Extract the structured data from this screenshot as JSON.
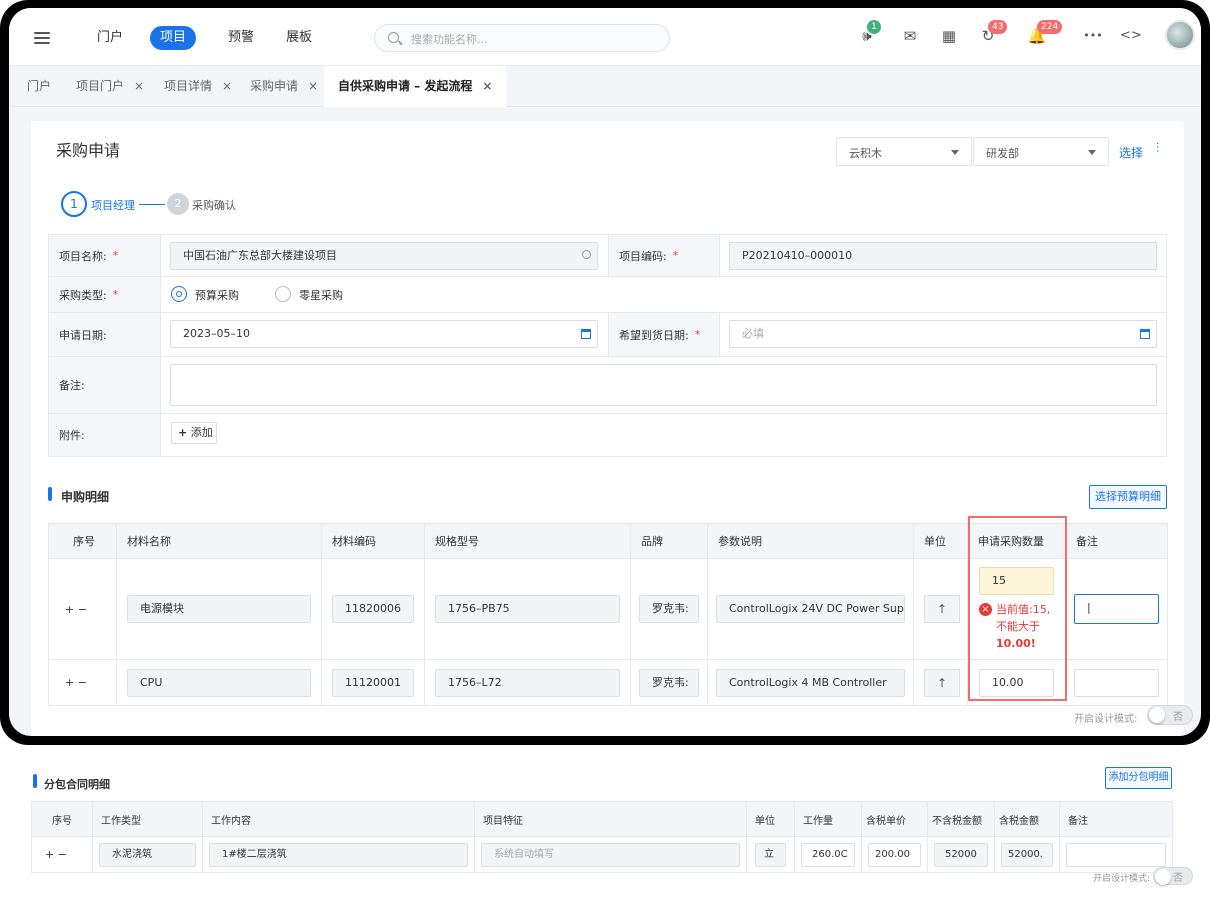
{
  "nav": {
    "items": [
      "门户",
      "项目",
      "预警",
      "展板"
    ],
    "active": "项目"
  },
  "search": {
    "placeholder": "搜索功能名称..."
  },
  "toolbar": {
    "badge_notify": "1",
    "badge_sync": "43",
    "badge_alarm": "224",
    "more": "•••",
    "code": "<>"
  },
  "tabs": [
    {
      "label": "门户"
    },
    {
      "label": "项目门户"
    },
    {
      "label": "项目详情"
    },
    {
      "label": "采购申请"
    },
    {
      "label": "自供采购申请 – 发起流程"
    }
  ],
  "page": {
    "title": "采购申请",
    "company": "云积木",
    "dept": "研发部",
    "select_link": "选择"
  },
  "steps": [
    {
      "num": "1",
      "label": "项目经理"
    },
    {
      "num": "2",
      "label": "采购确认"
    }
  ],
  "form": {
    "project_name_label": "项目名称:",
    "project_name": "中国石油广东总部大楼建设项目",
    "project_code_label": "项目编码:",
    "project_code": "P20210410–000010",
    "purchase_type_label": "采购类型:",
    "type_budget": "预算采购",
    "type_retail": "零星采购",
    "apply_date_label": "申请日期:",
    "apply_date": "2023–05–10",
    "arrive_date_label": "希望到货日期:",
    "arrive_placeholder": "必填",
    "remark_label": "备注:",
    "attach_label": "附件:",
    "add_label": "添加"
  },
  "detail": {
    "title": "申购明细",
    "select_btn": "选择预算明细",
    "headers": [
      "序号",
      "材料名称",
      "材料编码",
      "规格型号",
      "品牌",
      "参数说明",
      "单位",
      "申请采购数量",
      "备注"
    ],
    "rows": [
      {
        "name": "电源模块",
        "code": "11820006",
        "spec": "1756–PB75",
        "brand": "罗克韦:",
        "desc": "ControlLogix 24V DC Power Supp",
        "qty": "15"
      },
      {
        "name": "CPU",
        "code": "11120001",
        "spec": "1756–L72",
        "brand": "罗克韦:",
        "desc": "ControlLogix 4 MB Controller",
        "qty": "10.00"
      }
    ],
    "error_l1": "当前值:15,",
    "error_l2": "不能大于",
    "error_l3": "10.00!"
  },
  "design_mode": {
    "label": "开启设计模式:",
    "off": "否"
  },
  "sub": {
    "title": "分包合同明细",
    "add_btn": "添加分包明细",
    "headers": [
      "序号",
      "工作类型",
      "工作内容",
      "项目特征",
      "单位",
      "工作量",
      "含税单价",
      "不含税金额",
      "含税金额",
      "备注"
    ],
    "row": {
      "type": "水泥浇筑",
      "content": "1#楼二层浇筑",
      "feature": "系统自动填写",
      "unit": "立",
      "qty": "260.0C",
      "price": "200.00",
      "net": "52000",
      "gross": "52000."
    }
  },
  "colors": {
    "primary": "#1a73e8",
    "error": "#f56c6c",
    "green_badge": "#3fb27f"
  }
}
